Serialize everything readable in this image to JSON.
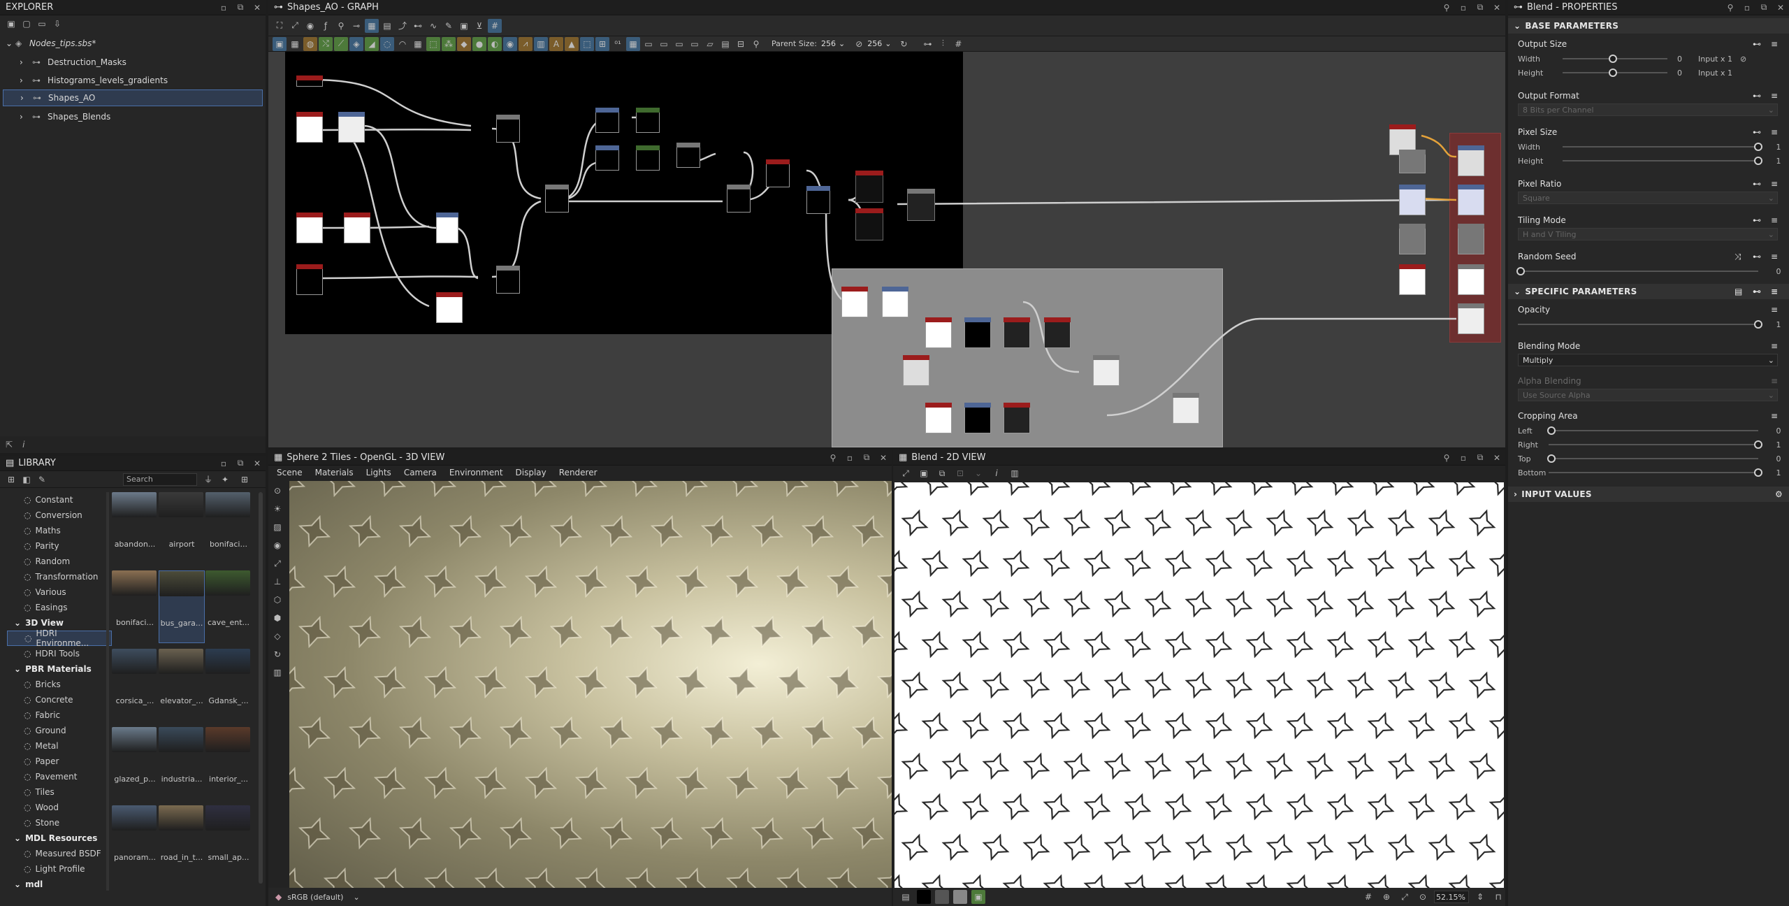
{
  "explorer": {
    "title": "EXPLORER",
    "package": "Nodes_tips.sbs*",
    "graphs": [
      "Destruction_Masks",
      "Histograms_levels_gradients",
      "Shapes_AO",
      "Shapes_Blends"
    ],
    "selected": "Shapes_AO"
  },
  "graph": {
    "title": "Shapes_AO - GRAPH",
    "parent_size_label": "Parent Size:",
    "parent_size_value": "256",
    "size_value": "256"
  },
  "library": {
    "title": "LIBRARY",
    "search_placeholder": "Search",
    "items": [
      {
        "label": "Constant",
        "type": "item"
      },
      {
        "label": "Conversion",
        "type": "item"
      },
      {
        "label": "Maths",
        "type": "item"
      },
      {
        "label": "Parity",
        "type": "item"
      },
      {
        "label": "Random",
        "type": "item"
      },
      {
        "label": "Transformation",
        "type": "item"
      },
      {
        "label": "Various",
        "type": "item"
      },
      {
        "label": "Easings",
        "type": "item"
      },
      {
        "label": "3D View",
        "type": "cat"
      },
      {
        "label": "HDRI Environme...",
        "type": "item",
        "selected": true
      },
      {
        "label": "HDRI Tools",
        "type": "item"
      },
      {
        "label": "PBR Materials",
        "type": "cat"
      },
      {
        "label": "Bricks",
        "type": "item"
      },
      {
        "label": "Concrete",
        "type": "item"
      },
      {
        "label": "Fabric",
        "type": "item"
      },
      {
        "label": "Ground",
        "type": "item"
      },
      {
        "label": "Metal",
        "type": "item"
      },
      {
        "label": "Paper",
        "type": "item"
      },
      {
        "label": "Pavement",
        "type": "item"
      },
      {
        "label": "Tiles",
        "type": "item"
      },
      {
        "label": "Wood",
        "type": "item"
      },
      {
        "label": "Stone",
        "type": "item"
      },
      {
        "label": "MDL Resources",
        "type": "cat"
      },
      {
        "label": "Measured BSDF",
        "type": "item"
      },
      {
        "label": "Light Profile",
        "type": "item"
      },
      {
        "label": "mdl",
        "type": "cat"
      }
    ],
    "thumbs": [
      [
        "abandon...",
        "airport",
        "bonifaci..."
      ],
      [
        "bonifaci...",
        "bus_gara...",
        "cave_ent..."
      ],
      [
        "corsica_...",
        "elevator_...",
        "Gdansk_..."
      ],
      [
        "glazed_p...",
        "industria...",
        "interior_..."
      ],
      [
        "panoram...",
        "road_in_t...",
        "small_ap..."
      ]
    ]
  },
  "view3d": {
    "title": "Sphere 2 Tiles - OpenGL - 3D VIEW",
    "menu": [
      "Scene",
      "Materials",
      "Lights",
      "Camera",
      "Environment",
      "Display",
      "Renderer"
    ],
    "colorspace": "sRGB (default)"
  },
  "view2d": {
    "title": "Blend - 2D VIEW",
    "zoom": "52.15%"
  },
  "properties": {
    "title": "Blend - PROPERTIES",
    "base_parameters": "BASE PARAMETERS",
    "output_size": "Output Size",
    "width_label": "Width",
    "height_label": "Height",
    "width_value": "0",
    "height_value": "0",
    "width_mode": "Input x 1",
    "height_mode": "Input x 1",
    "output_format": "Output Format",
    "output_format_value": "8 Bits per Channel",
    "pixel_size": "Pixel Size",
    "pixel_width_value": "1",
    "pixel_height_value": "1",
    "pixel_ratio": "Pixel Ratio",
    "pixel_ratio_value": "Square",
    "tiling_mode": "Tiling Mode",
    "tiling_mode_value": "H and V Tiling",
    "random_seed": "Random Seed",
    "random_seed_value": "0",
    "specific_parameters": "SPECIFIC PARAMETERS",
    "opacity": "Opacity",
    "opacity_value": "1",
    "blending_mode": "Blending Mode",
    "blending_mode_value": "Multiply",
    "alpha_blending": "Alpha Blending",
    "alpha_blending_value": "Use Source Alpha",
    "cropping_area": "Cropping Area",
    "left_label": "Left",
    "right_label": "Right",
    "top_label": "Top",
    "bottom_label": "Bottom",
    "left_value": "0",
    "right_value": "1",
    "top_value": "0",
    "bottom_value": "1",
    "input_values": "INPUT VALUES"
  }
}
